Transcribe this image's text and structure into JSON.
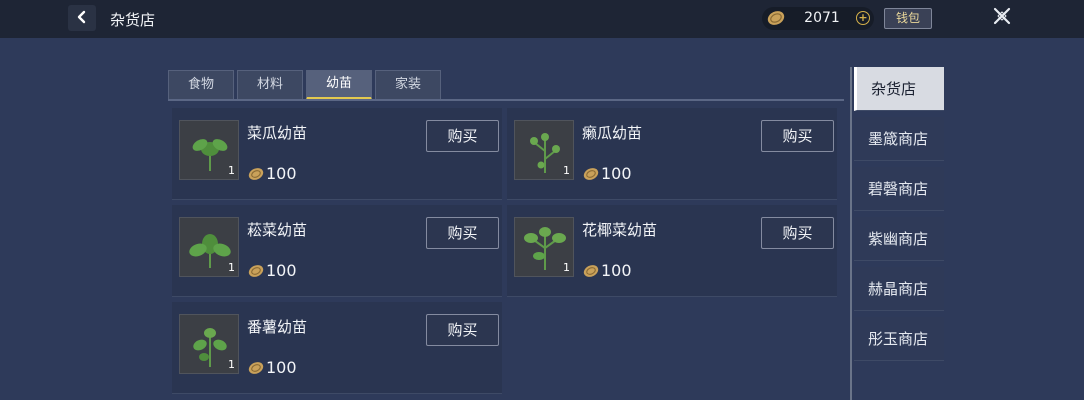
{
  "header": {
    "title": "杂货店",
    "coins": "2071",
    "wallet_label": "钱包"
  },
  "tabs": [
    {
      "label": "食物",
      "active": false
    },
    {
      "label": "材料",
      "active": false
    },
    {
      "label": "幼苗",
      "active": true
    },
    {
      "label": "家装",
      "active": false
    }
  ],
  "items": [
    {
      "name": "菜瓜幼苗",
      "qty": "1",
      "price": "100",
      "buy_label": "购买"
    },
    {
      "name": "癞瓜幼苗",
      "qty": "1",
      "price": "100",
      "buy_label": "购买"
    },
    {
      "name": "菘菜幼苗",
      "qty": "1",
      "price": "100",
      "buy_label": "购买"
    },
    {
      "name": "花椰菜幼苗",
      "qty": "1",
      "price": "100",
      "buy_label": "购买"
    },
    {
      "name": "番薯幼苗",
      "qty": "1",
      "price": "100",
      "buy_label": "购买"
    }
  ],
  "shops": [
    {
      "label": "杂货店",
      "active": true
    },
    {
      "label": "墨箴商店",
      "active": false
    },
    {
      "label": "碧磬商店",
      "active": false
    },
    {
      "label": "紫幽商店",
      "active": false
    },
    {
      "label": "赫晶商店",
      "active": false
    },
    {
      "label": "彤玉商店",
      "active": false
    }
  ],
  "colors": {
    "background": "#2e3a5a",
    "topbar": "#1e2535",
    "active_tab_underline": "#e3c94f",
    "coin_gold": "#c9a15a"
  },
  "icons": {
    "back": "chevron-left-icon",
    "coin": "coin-icon",
    "add": "plus-icon",
    "close": "close-icon",
    "seedling": "seedling-icon"
  }
}
